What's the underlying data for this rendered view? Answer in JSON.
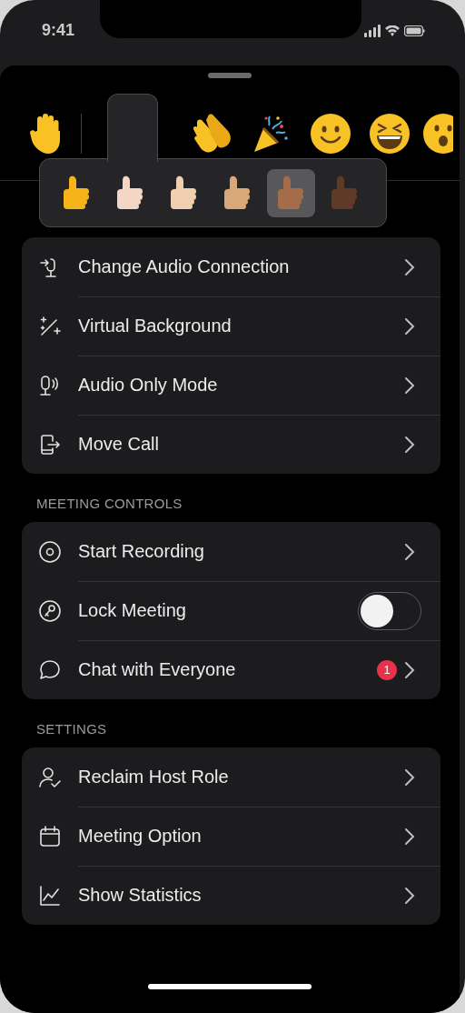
{
  "status_bar": {
    "time": "9:41"
  },
  "reactions": [
    {
      "kind": "hand"
    },
    {
      "kind": "divider"
    },
    {
      "kind": "slot"
    },
    {
      "kind": "clap"
    },
    {
      "kind": "party"
    },
    {
      "kind": "smile"
    },
    {
      "kind": "laugh"
    },
    {
      "kind": "surprised"
    }
  ],
  "skin_tones": [
    {
      "color": "#f4b41a",
      "selected": false
    },
    {
      "color": "#f3d6c4",
      "selected": false
    },
    {
      "color": "#efcfb0",
      "selected": false
    },
    {
      "color": "#d8a878",
      "selected": false
    },
    {
      "color": "#a46c48",
      "selected": true
    },
    {
      "color": "#5e3b26",
      "selected": false
    }
  ],
  "groups": [
    {
      "items": [
        {
          "label": "Change Audio Connection",
          "kind": "link"
        },
        {
          "label": "Virtual Background",
          "kind": "link"
        },
        {
          "label": "Audio Only Mode",
          "kind": "link"
        },
        {
          "label": "Move Call",
          "kind": "link"
        }
      ]
    },
    {
      "header": "MEETING CONTROLS",
      "items": [
        {
          "label": "Start Recording",
          "kind": "link"
        },
        {
          "label": "Lock Meeting",
          "kind": "toggle",
          "on": false
        },
        {
          "label": "Chat with Everyone",
          "kind": "link",
          "badge": "1"
        }
      ]
    },
    {
      "header": "SETTINGS",
      "items": [
        {
          "label": "Reclaim Host Role",
          "kind": "link"
        },
        {
          "label": "Meeting Option",
          "kind": "link"
        },
        {
          "label": "Show Statistics",
          "kind": "link"
        }
      ]
    }
  ]
}
